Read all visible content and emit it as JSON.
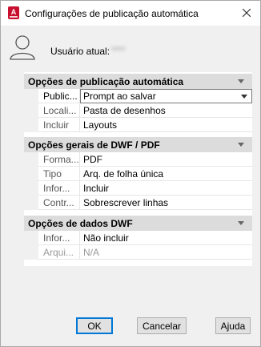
{
  "window": {
    "title": "Configurações de publicação automática",
    "app_icon": "autocad-icon",
    "accent_color": "#c8102e"
  },
  "user": {
    "label": "Usuário atual:",
    "value": "•••••"
  },
  "sections": [
    {
      "title": "Opções de publicação automática",
      "rows": [
        {
          "name": "Public...",
          "value": "Prompt ao salvar"
        },
        {
          "name": "Locali...",
          "value": "Pasta de desenhos"
        },
        {
          "name": "Incluir",
          "value": "Layouts"
        }
      ]
    },
    {
      "title": "Opções gerais de DWF / PDF",
      "rows": [
        {
          "name": "Forma...",
          "value": "PDF"
        },
        {
          "name": "Tipo",
          "value": "Arq. de folha única"
        },
        {
          "name": "Infor...",
          "value": "Incluir"
        },
        {
          "name": "Contr...",
          "value": "Sobrescrever linhas"
        }
      ]
    },
    {
      "title": "Opções de dados DWF",
      "rows": [
        {
          "name": "Infor...",
          "value": "Não incluir"
        },
        {
          "name": "Arqui...",
          "value": "N/A"
        }
      ]
    }
  ],
  "buttons": {
    "ok": "OK",
    "cancel": "Cancelar",
    "help": "Ajuda"
  }
}
